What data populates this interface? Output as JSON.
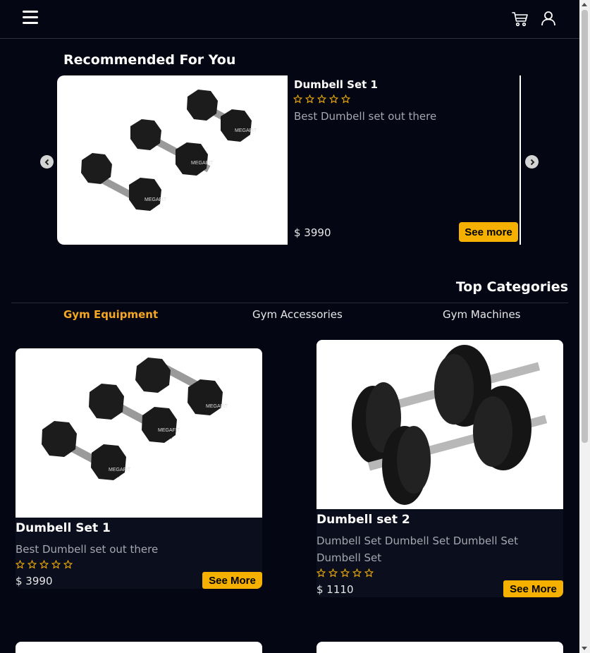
{
  "header": {
    "menu_icon": "hamburger-icon",
    "cart_icon": "cart-icon",
    "user_icon": "user-icon"
  },
  "recommended": {
    "title": "Recommended For You",
    "item": {
      "name": "Dumbell Set 1",
      "rating": 0,
      "description": "Best Dumbell set out there",
      "price": "$ 3990",
      "button_label": "See more"
    }
  },
  "categories": {
    "title": "Top Categories",
    "tabs": [
      {
        "label": "Gym Equipment",
        "active": true
      },
      {
        "label": "Gym Accessories",
        "active": false
      },
      {
        "label": "Gym Machines",
        "active": false
      }
    ]
  },
  "products": [
    {
      "name": "Dumbell Set 1",
      "description": "Best Dumbell set out there",
      "price": "$ 3990",
      "rating": 0,
      "button_label": "See More"
    },
    {
      "name": "Dumbell set 2",
      "description": "Dumbell Set Dumbell Set Dumbell Set Dumbell Set",
      "price": "$ 1110",
      "rating": 0,
      "button_label": "See More"
    }
  ],
  "colors": {
    "background": "#050614",
    "accent": "#f5b000",
    "active_tab": "#f5a623",
    "star_outline": "#f5b000"
  }
}
